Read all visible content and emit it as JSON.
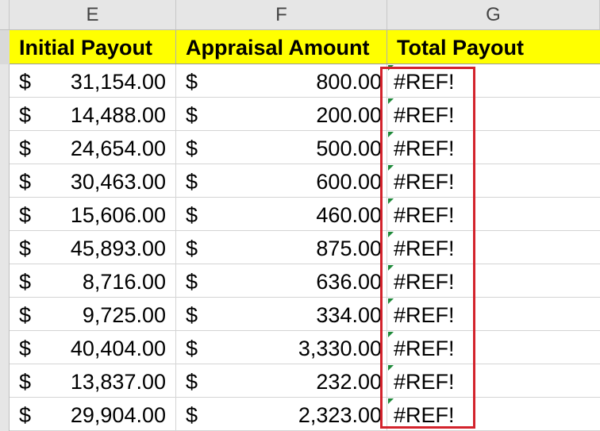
{
  "columns": [
    "E",
    "F",
    "G"
  ],
  "headers": {
    "e": "Initial Payout",
    "f": "Appraisal Amount",
    "g": "Total Payout"
  },
  "currency_symbol": "$",
  "rows": [
    {
      "initial": "31,154.00",
      "appraisal": "800.00",
      "total": "#REF!"
    },
    {
      "initial": "14,488.00",
      "appraisal": "200.00",
      "total": "#REF!"
    },
    {
      "initial": "24,654.00",
      "appraisal": "500.00",
      "total": "#REF!"
    },
    {
      "initial": "30,463.00",
      "appraisal": "600.00",
      "total": "#REF!"
    },
    {
      "initial": "15,606.00",
      "appraisal": "460.00",
      "total": "#REF!"
    },
    {
      "initial": "45,893.00",
      "appraisal": "875.00",
      "total": "#REF!"
    },
    {
      "initial": "8,716.00",
      "appraisal": "636.00",
      "total": "#REF!"
    },
    {
      "initial": "9,725.00",
      "appraisal": "334.00",
      "total": "#REF!"
    },
    {
      "initial": "40,404.00",
      "appraisal": "3,330.00",
      "total": "#REF!"
    },
    {
      "initial": "13,837.00",
      "appraisal": "232.00",
      "total": "#REF!"
    },
    {
      "initial": "29,904.00",
      "appraisal": "2,323.00",
      "total": "#REF!"
    }
  ],
  "colors": {
    "header_fill": "#ffff00",
    "highlight_border": "#d3232c",
    "error_indicator": "#1e8a3a"
  },
  "icons": {
    "error_indicator": "green-triangle-icon"
  }
}
